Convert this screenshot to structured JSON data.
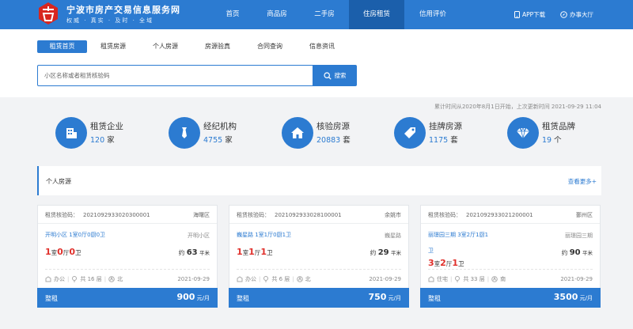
{
  "header": {
    "title": "宁波市房产交易信息服务网",
    "subtitle": "权威 · 真实 · 及时 · 全域",
    "nav": [
      "首页",
      "商品房",
      "二手房",
      "住房租赁",
      "信用评价"
    ],
    "nav_active": "住房租赁",
    "app_download": "APP下载",
    "service_hall": "办事大厅"
  },
  "subnav": {
    "tabs": [
      "租赁首页",
      "租赁房源",
      "个人房源",
      "房源验真",
      "合同查询",
      "信息资讯"
    ],
    "active_tab": "租赁首页"
  },
  "search": {
    "placeholder": "小区名称或者租赁核验码",
    "button": "搜索"
  },
  "stats": {
    "note": "累计时间从2020年8月1日开始，上次更新时间 2021-09-29 11:04",
    "items": [
      {
        "label": "租赁企业",
        "value": "120",
        "unit": "家",
        "icon": "building-icon"
      },
      {
        "label": "经纪机构",
        "value": "4755",
        "unit": "家",
        "icon": "tie-icon"
      },
      {
        "label": "核验房源",
        "value": "20883",
        "unit": "套",
        "icon": "house-icon"
      },
      {
        "label": "挂牌房源",
        "value": "1175",
        "unit": "套",
        "icon": "tag-icon"
      },
      {
        "label": "租赁品牌",
        "value": "19",
        "unit": "个",
        "icon": "diamond-icon"
      }
    ]
  },
  "section": {
    "title": "个人房源",
    "more": "查看更多+"
  },
  "listings": [
    {
      "code_label": "租赁核验码：",
      "code": "2021092933020300001",
      "district": "海曙区",
      "title": "开明小区 1室0厅0厨0卫",
      "community": "开明小区",
      "rooms": [
        "1",
        "0",
        "0"
      ],
      "area": "63",
      "area_unit": "平米",
      "usage": "办公",
      "floor": "共 16 层",
      "orientation": "北",
      "date": "2021-09-29",
      "rent_type": "整租",
      "price": "900",
      "price_unit": "元/月"
    },
    {
      "code_label": "租赁核验码：",
      "code": "2021092933028100001",
      "district": "余姚市",
      "title": "巍星路 1室1厅0厨1卫",
      "community": "巍星路",
      "rooms": [
        "1",
        "1",
        "1"
      ],
      "area": "29",
      "area_unit": "平米",
      "usage": "办公",
      "floor": "共 6 层",
      "orientation": "北",
      "date": "2021-09-29",
      "rent_type": "整租",
      "price": "750",
      "price_unit": "元/月"
    },
    {
      "code_label": "租赁核验码：",
      "code": "2021092933021200001",
      "district": "鄞州区",
      "title": "丽璟园三期 3室2厅1厨1",
      "title_cont": "卫",
      "community": "丽璟园三期",
      "rooms": [
        "3",
        "2",
        "1"
      ],
      "area": "90",
      "area_unit": "平米",
      "usage": "住宅",
      "floor": "共 33 层",
      "orientation": "南",
      "date": "2021-09-29",
      "rent_type": "整租",
      "price": "3500",
      "price_unit": "元/月"
    }
  ],
  "labels": {
    "room": "室",
    "hall": "厅",
    "bath": "卫"
  },
  "colors": {
    "primary": "#2c7bd1",
    "nav_active": "#1b5fab",
    "accent_red": "#e0302b"
  }
}
